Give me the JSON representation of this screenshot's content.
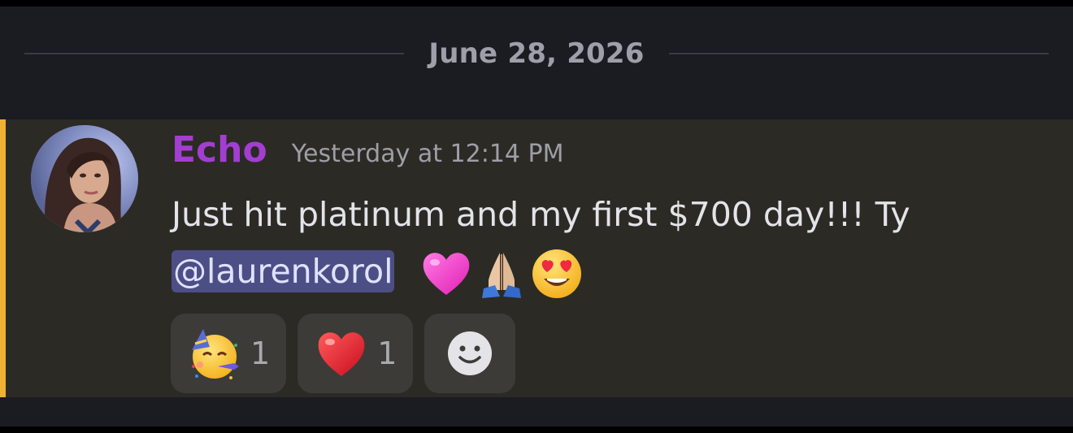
{
  "date_divider": {
    "label": "June 28, 2026"
  },
  "message": {
    "author": "Echo",
    "timestamp": "Yesterday at 12:14 PM",
    "text": "Just hit platinum and my first $700 day!!! Ty",
    "mention": "@laurenkorol",
    "emojis": [
      "pink-heart-icon",
      "folded-hands-icon",
      "heart-eyes-face-icon"
    ],
    "reactions": [
      {
        "emoji": "partying-face-icon",
        "count": "1"
      },
      {
        "emoji": "red-heart-icon",
        "count": "1"
      }
    ],
    "add_reaction_icon": "smiley-face-icon"
  },
  "colors": {
    "background": "#1b1c22",
    "message_highlight": "#2c2a25",
    "mention_bar": "#f0b232",
    "author": "#a23ed1",
    "mention_bg": "#4c4f86"
  }
}
